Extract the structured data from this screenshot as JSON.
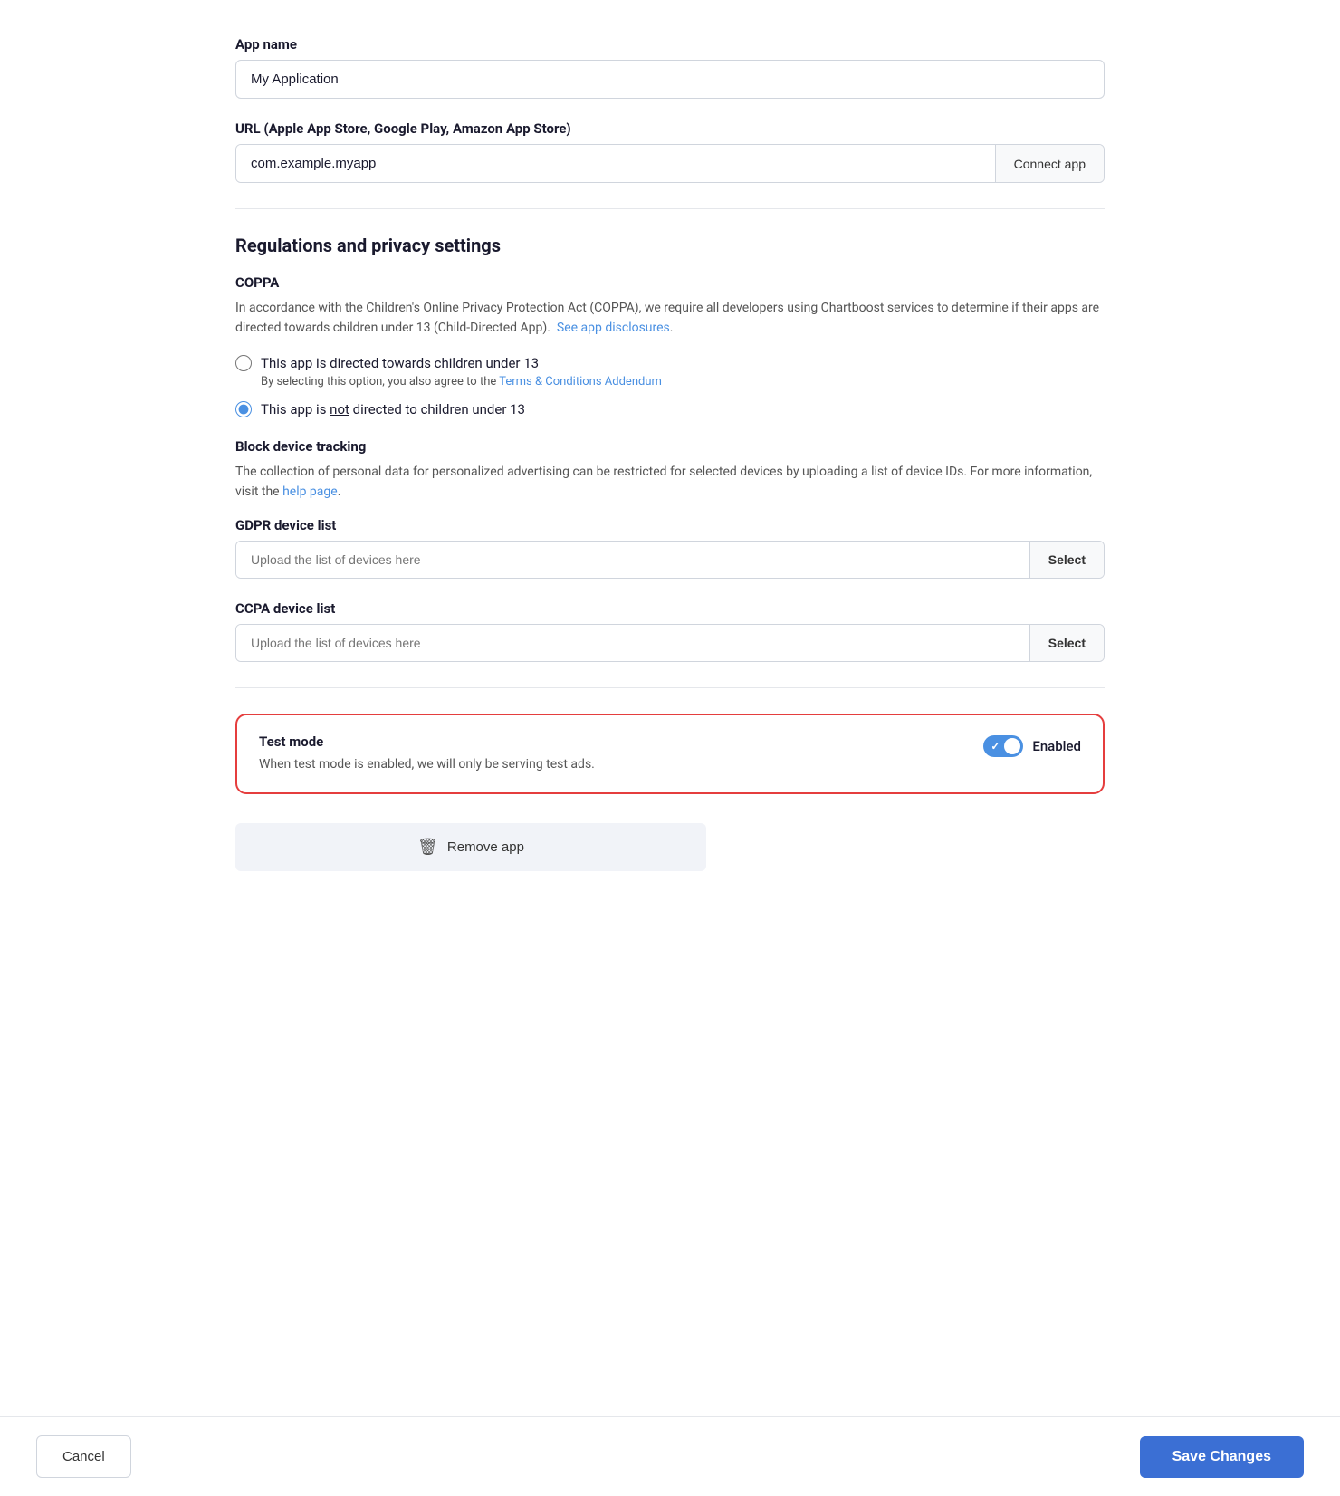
{
  "app_name": {
    "label": "App name",
    "value": "My Application",
    "placeholder": "My Application"
  },
  "url_field": {
    "label": "URL (Apple App Store, Google Play, Amazon App Store)",
    "value": "com.example.myapp",
    "placeholder": "com.example.myapp",
    "connect_button": "Connect app"
  },
  "regulations_section": {
    "title": "Regulations and privacy settings",
    "coppa": {
      "title": "COPPA",
      "description": "In accordance with the Children's Online Privacy Protection Act (COPPA), we require all developers using Chartboost services to determine if their apps are directed towards children under 13 (Child-Directed App).",
      "see_disclosures_link": "See app disclosures",
      "radio_child_directed": {
        "label": "This app is directed towards children under 13",
        "sublabel_prefix": "By selecting this option, you also agree to the ",
        "terms_link": "Terms & Conditions Addendum",
        "checked": false
      },
      "radio_not_child_directed": {
        "label_before": "This app is ",
        "label_underline": "not",
        "label_after": " directed to children under 13",
        "checked": true
      }
    },
    "block_device_tracking": {
      "title": "Block device tracking",
      "description_prefix": "The collection of personal data for personalized advertising can be restricted for selected devices by uploading a list of device IDs. For more information, visit the ",
      "help_link": "help page",
      "description_suffix": "."
    },
    "gdpr_device_list": {
      "label": "GDPR device list",
      "placeholder": "Upload the list of devices here",
      "select_button": "Select"
    },
    "ccpa_device_list": {
      "label": "CCPA device list",
      "placeholder": "Upload the list of devices here",
      "select_button": "Select"
    }
  },
  "test_mode": {
    "title": "Test mode",
    "description": "When test mode is enabled, we will only be serving test ads.",
    "toggle_label": "Enabled",
    "enabled": true
  },
  "remove_app": {
    "label": "Remove app",
    "icon": "🗑"
  },
  "footer": {
    "cancel_label": "Cancel",
    "save_label": "Save Changes"
  }
}
